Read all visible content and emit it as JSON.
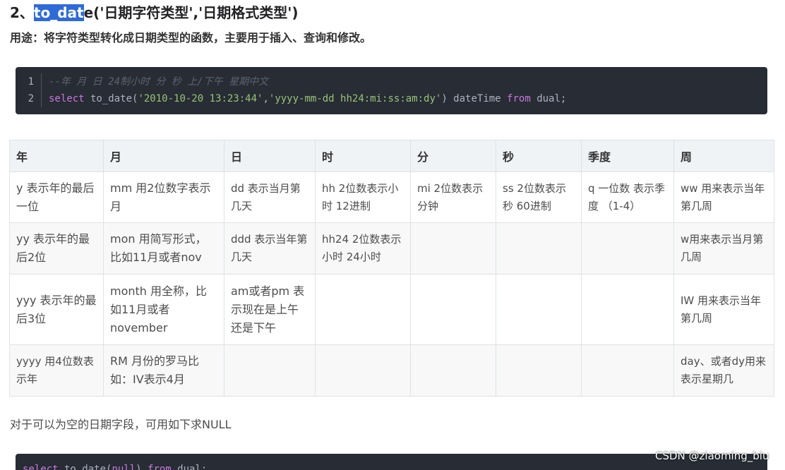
{
  "heading": {
    "prefix": "2、",
    "selected": "to_dat",
    "rest": "e('日期字符类型','日期格式类型')"
  },
  "purpose": "用途：将字符类型转化成日期类型的函数，主要用于插入、查询和修改。",
  "code_block_1": {
    "line1_no": "1",
    "line1_comment": "--年 月 日 24制小时 分 秒 上/下午 星期中文",
    "line2_no": "2",
    "line2": {
      "kw_select": "select",
      "fn": " to_date(",
      "str1": "'2010-10-20 13:23:44'",
      "comma": ",",
      "str2": "'yyyy-mm-dd hh24:mi:ss:am:dy'",
      "mid": ") dateTime ",
      "kw_from": "from",
      "tail": " dual;"
    }
  },
  "table": {
    "headers": [
      "年",
      "月",
      "日",
      "时",
      "分",
      "秒",
      "季度",
      "周"
    ],
    "rows": [
      [
        "y 表示年的最后一位",
        "mm 用2位数字表示月",
        "dd 表示当月第几天",
        "hh 2位数表示小时 12进制",
        "mi 2位数表示分钟",
        "ss 2位数表示秒 60进制",
        "q 一位数 表示季度 （1-4）",
        "ww 用来表示当年第几周"
      ],
      [
        "yy 表示年的最后2位",
        "mon 用简写形式，比如11月或者nov",
        "ddd 表示当年第几天",
        "hh24 2位数表示小时 24小时",
        "",
        "",
        "",
        "w用来表示当月第几周"
      ],
      [
        "yyy 表示年的最后3位",
        "month 用全称，比如11月或者november",
        "am或者pm 表示现在是上午还是下午",
        "",
        "",
        "",
        "",
        "IW 用来表示当年第几周"
      ],
      [
        "yyyy 用4位数表示年",
        "RM 月份的罗马比如：IV表示4月",
        "",
        "",
        "",
        "",
        "",
        "day、或者dy用来表示星期几"
      ]
    ]
  },
  "note": "对于可以为空的日期字段，可用如下求NULL",
  "code_block_2": {
    "kw_select": "select",
    "fn": " to_date(",
    "kw_null": "null",
    "mid": ") ",
    "kw_from": "from",
    "tail": " dual;"
  },
  "watermark": "CSDN @ziaoming_biu"
}
